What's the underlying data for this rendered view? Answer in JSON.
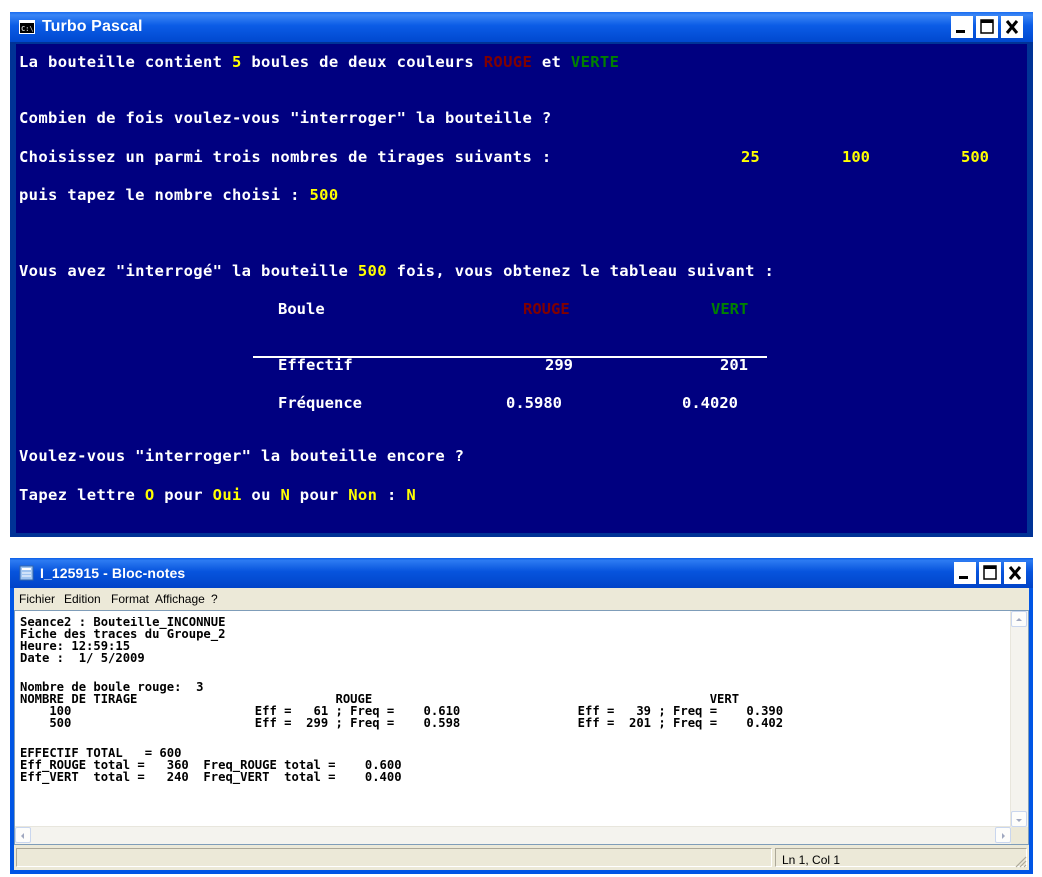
{
  "turbo": {
    "title": "Turbo Pascal",
    "lines": {
      "l1_a": "La bouteille contient ",
      "l1_n": "5",
      "l1_b": " boules de deux couleurs ",
      "l1_rouge": "ROUGE",
      "l1_c": " et ",
      "l1_verte": "VERTE",
      "l2": "Combien de fois voulez-vous \"interroger\" la bouteille ?",
      "l3": "Choisissez un parmi trois nombres de tirages suivants : ",
      "opt1": "25",
      "opt2": "100",
      "opt3": "500",
      "l4": "puis tapez le nombre choisi : ",
      "l4_v": "500",
      "l5_a": "Vous avez \"interrogé\" la bouteille ",
      "l5_n": "500",
      "l5_b": " fois, vous obtenez le tableau suivant :",
      "l6": "Voulez-vous \"interroger\" la bouteille encore ?",
      "l7_a": "Tapez lettre ",
      "l7_o": "O",
      "l7_b": " pour ",
      "l7_oui": "Oui",
      "l7_c": " ou ",
      "l7_n": "N",
      "l7_d": " pour ",
      "l7_non": "Non",
      "l7_e": " : ",
      "l7_ans": "N"
    },
    "table": {
      "col0": "Boule",
      "col1": "ROUGE",
      "col2": "VERT",
      "r1_label": "Effectif",
      "r1_rouge": "299",
      "r1_vert": "201",
      "r2_label": "Fréquence",
      "r2_rouge": "0.5980",
      "r2_vert": "0.4020"
    }
  },
  "notepad": {
    "title": "I_125915 - Bloc-notes",
    "menu": [
      "Fichier",
      "Edition",
      "Format",
      "Affichage",
      "?"
    ],
    "lines": [
      "Seance2 : Bouteille_INCONNUE",
      "Fiche des traces du Groupe_2",
      "Heure: 12:59:15",
      "Date :  1/ 5/2009",
      "",
      "Nombre de boule rouge:  3",
      "NOMBRE DE TIRAGE                           ROUGE                                              VERT",
      "    100                         Eff =   61 ; Freq =    0.610                Eff =   39 ; Freq =    0.390",
      "    500                         Eff =  299 ; Freq =    0.598                Eff =  201 ; Freq =    0.402",
      "",
      "EFFECTIF TOTAL   = 600",
      "Eff_ROUGE total =   360  Freq_ROUGE total =    0.600",
      "Eff_VERT  total =   240  Freq_VERT  total =    0.400"
    ],
    "status": "Ln 1, Col 1"
  },
  "colors": {
    "console_bg": "#000080",
    "console_text": "#ffffff",
    "highlight": "#ffff00",
    "rouge": "#800000",
    "verte": "#008000",
    "xp_titlebar": "#0055e5"
  }
}
